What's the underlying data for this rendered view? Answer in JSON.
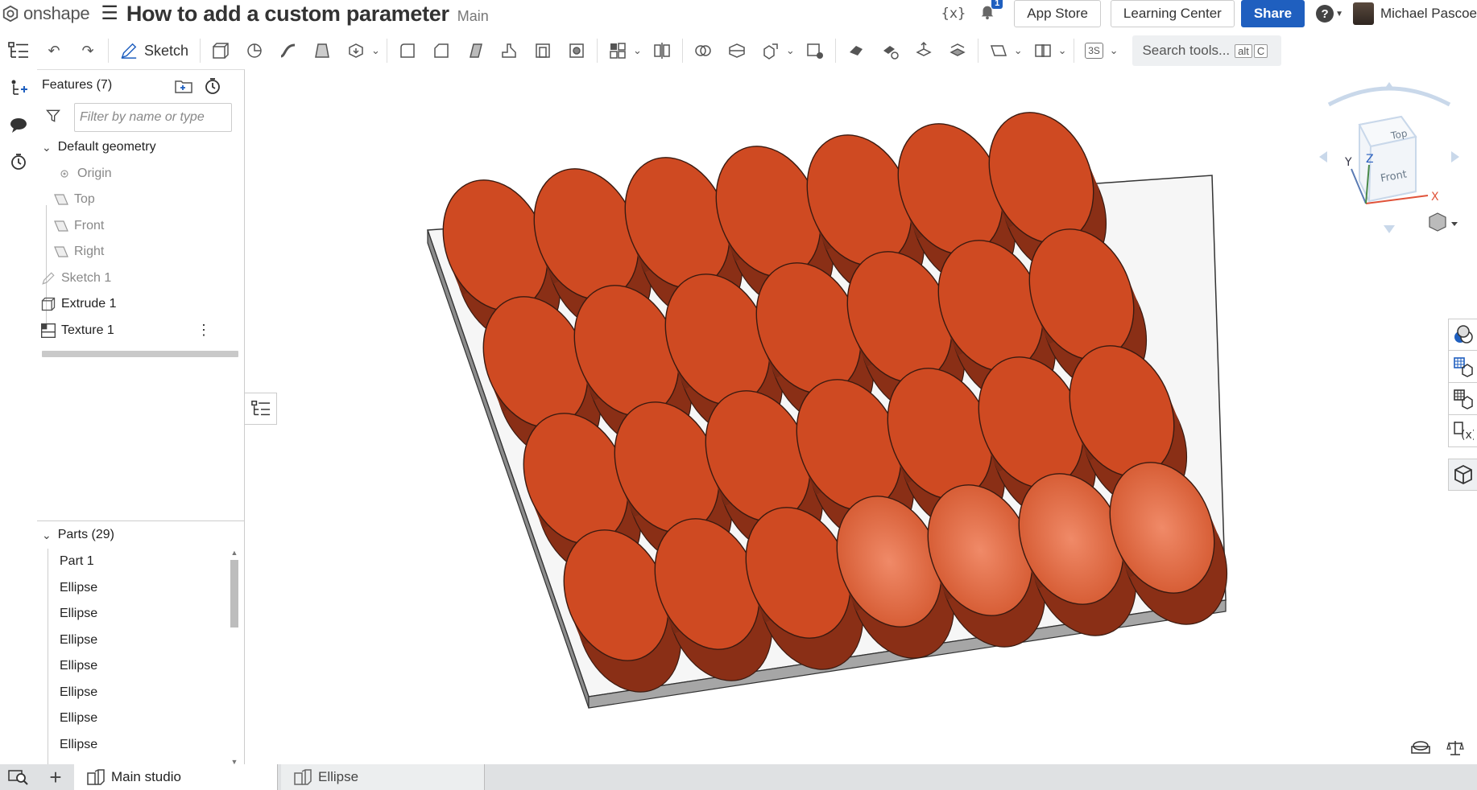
{
  "app": {
    "logo_text": "onshape",
    "document_title": "How to add a custom parameter",
    "branch": "Main"
  },
  "topbar": {
    "notification_count": "1",
    "app_store": "App Store",
    "learning_center": "Learning Center",
    "share": "Share",
    "user_name": "Michael Pascoe",
    "variable_icon": "{x}"
  },
  "toolbar": {
    "sketch_label": "Sketch",
    "search_placeholder": "Search tools...",
    "search_kbd_1": "alt",
    "search_kbd_2": "C",
    "units_badge": "3S"
  },
  "features": {
    "title": "Features (7)",
    "filter_placeholder": "Filter by name or type",
    "default_geometry": "Default geometry",
    "origin": "Origin",
    "top": "Top",
    "front": "Front",
    "right": "Right",
    "sketch1": "Sketch 1",
    "extrude1": "Extrude 1",
    "texture1": "Texture 1"
  },
  "parts": {
    "title": "Parts (29)",
    "items": [
      "Part 1",
      "Ellipse",
      "Ellipse",
      "Ellipse",
      "Ellipse",
      "Ellipse",
      "Ellipse",
      "Ellipse"
    ]
  },
  "view_cube": {
    "top": "Top",
    "front": "Front",
    "axis_x": "X",
    "axis_y": "Y",
    "axis_z": "Z"
  },
  "tabs": [
    {
      "label": "Main studio"
    },
    {
      "label": "Ellipse"
    }
  ],
  "colors": {
    "accent": "#1f5fbf",
    "part_orange": "#cf4a22",
    "base_plate": "#9a9a9a"
  }
}
